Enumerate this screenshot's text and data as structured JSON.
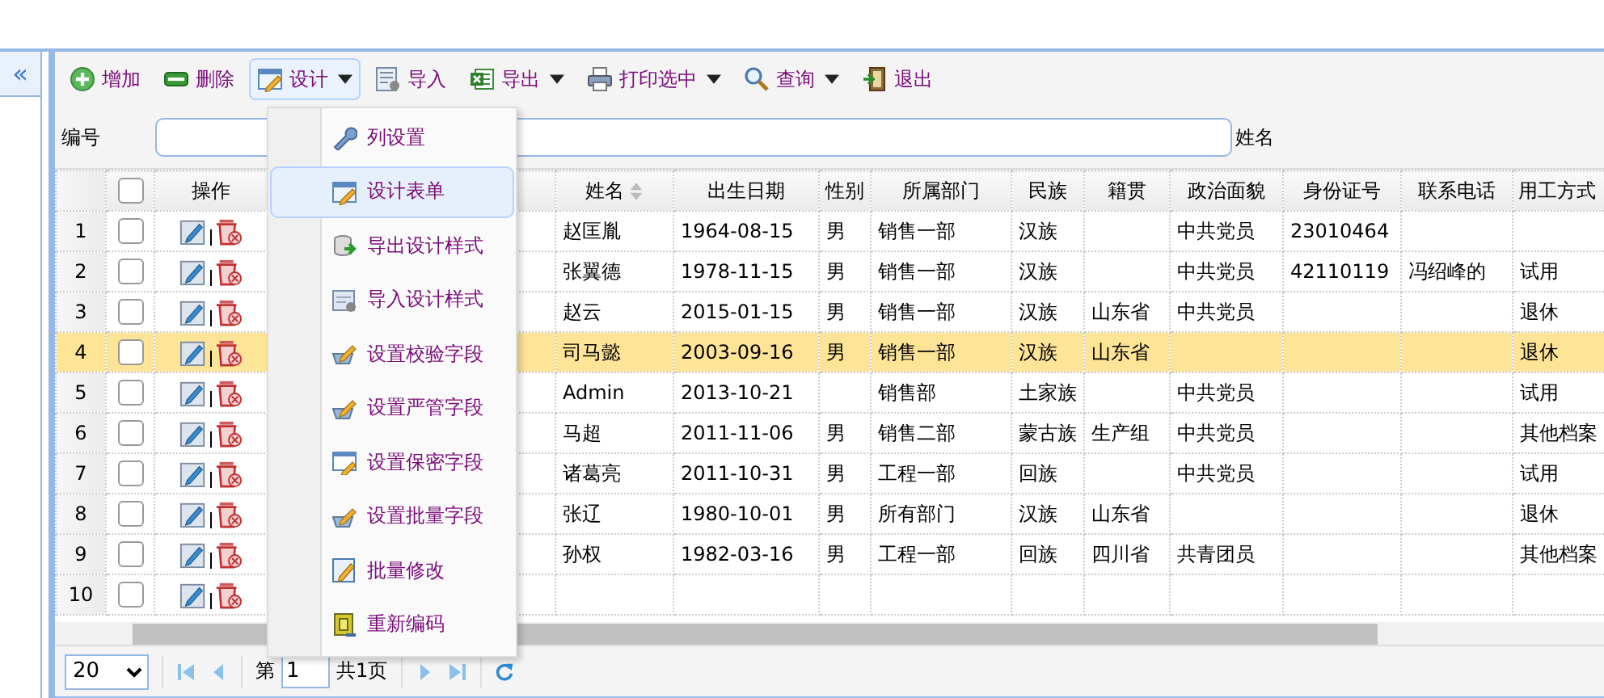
{
  "sidebar": {
    "collapse_button": "«"
  },
  "toolbar": [
    {
      "label": "增加",
      "dropdown": false,
      "open": false
    },
    {
      "label": "删除",
      "dropdown": false,
      "open": false
    },
    {
      "label": "设计",
      "dropdown": true,
      "open": true
    },
    {
      "label": "导入",
      "dropdown": false,
      "open": false
    },
    {
      "label": "导出",
      "dropdown": true,
      "open": false
    },
    {
      "label": "打印选中",
      "dropdown": true,
      "open": false
    },
    {
      "label": "查询",
      "dropdown": true,
      "open": false
    },
    {
      "label": "退出",
      "dropdown": false,
      "open": false
    }
  ],
  "search": {
    "fields": [
      {
        "label": "编号"
      },
      {
        "label": "姓名"
      }
    ]
  },
  "table": {
    "action_column": "操作",
    "all_checked": false,
    "columns": [
      {
        "label": "姓名",
        "sort_icon": true
      },
      {
        "label": "出生日期",
        "sort_icon": false
      },
      {
        "label": "性别",
        "sort_icon": false
      },
      {
        "label": "所属部门",
        "sort_icon": false
      },
      {
        "label": "民族",
        "sort_icon": false
      },
      {
        "label": "籍贯",
        "sort_icon": false
      },
      {
        "label": "政治面貌",
        "sort_icon": false
      },
      {
        "label": "身份证号",
        "sort_icon": false
      },
      {
        "label": "联系电话",
        "sort_icon": false
      },
      {
        "label": "用工方式",
        "sort_icon": false
      }
    ],
    "rows": [
      {
        "num": "1",
        "checked": false,
        "selected": false,
        "cells": [
          "赵匡胤",
          "1964-08-15",
          "男",
          "销售一部",
          "汉族",
          "",
          "中共党员",
          "23010464",
          "",
          ""
        ]
      },
      {
        "num": "2",
        "checked": false,
        "selected": false,
        "cells": [
          "张翼德",
          "1978-11-15",
          "男",
          "销售一部",
          "汉族",
          "",
          "中共党员",
          "42110119",
          "冯绍峰的",
          "试用"
        ]
      },
      {
        "num": "3",
        "checked": false,
        "selected": false,
        "cells": [
          "赵云",
          "2015-01-15",
          "男",
          "销售一部",
          "汉族",
          "山东省",
          "中共党员",
          "",
          "",
          "退休"
        ]
      },
      {
        "num": "4",
        "checked": false,
        "selected": true,
        "cells": [
          "司马懿",
          "2003-09-16",
          "男",
          "销售一部",
          "汉族",
          "山东省",
          "",
          "",
          "",
          "退休"
        ]
      },
      {
        "num": "5",
        "checked": false,
        "selected": false,
        "cells": [
          "Admin",
          "2013-10-21",
          "",
          "销售部",
          "土家族",
          "",
          "中共党员",
          "",
          "",
          "试用"
        ]
      },
      {
        "num": "6",
        "checked": false,
        "selected": false,
        "cells": [
          "马超",
          "2011-11-06",
          "男",
          "销售二部",
          "蒙古族",
          "生产组",
          "中共党员",
          "",
          "",
          "其他档案"
        ]
      },
      {
        "num": "7",
        "checked": false,
        "selected": false,
        "cells": [
          "诸葛亮",
          "2011-10-31",
          "男",
          "工程一部",
          "回族",
          "",
          "中共党员",
          "",
          "",
          "试用"
        ]
      },
      {
        "num": "8",
        "checked": false,
        "selected": false,
        "cells": [
          "张辽",
          "1980-10-01",
          "男",
          "所有部门",
          "汉族",
          "山东省",
          "",
          "",
          "",
          "退休"
        ]
      },
      {
        "num": "9",
        "checked": false,
        "selected": false,
        "cells": [
          "孙权",
          "1982-03-16",
          "男",
          "工程一部",
          "回族",
          "四川省",
          "共青团员",
          "",
          "",
          "其他档案"
        ]
      },
      {
        "num": "10",
        "checked": false,
        "selected": false,
        "cells": []
      }
    ]
  },
  "pager": {
    "page_size": "20",
    "page_label": "第",
    "page": "1",
    "total": "共1页"
  },
  "menu": {
    "items": [
      {
        "label": "列设置",
        "highlighted": false
      },
      {
        "label": "设计表单",
        "highlighted": true
      },
      {
        "label": "导出设计样式",
        "highlighted": false
      },
      {
        "label": "导入设计样式",
        "highlighted": false
      },
      {
        "label": "设置校验字段",
        "highlighted": false
      },
      {
        "label": "设置严管字段",
        "highlighted": false
      },
      {
        "label": "设置保密字段",
        "highlighted": false
      },
      {
        "label": "设置批量字段",
        "highlighted": false
      },
      {
        "label": "批量修改",
        "highlighted": false
      },
      {
        "label": "重新编码",
        "highlighted": false
      }
    ]
  }
}
